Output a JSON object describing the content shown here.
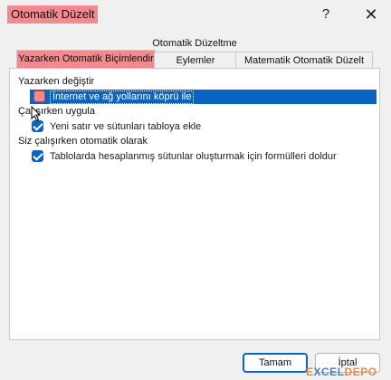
{
  "window": {
    "title": "Otomatik Düzelt",
    "help_icon": "?",
    "close_icon": "✕"
  },
  "tabs": {
    "row1": "Otomatik Düzeltme",
    "active": "Yazarken Otomatik Biçimlendir",
    "eylemler": "Eylemler",
    "math": "Matematik Otomatik Düzelt"
  },
  "sections": [
    {
      "label": "Yazarken değiştir",
      "items": [
        {
          "label": "İnternet ve ağ yollarını köprü ile",
          "checked": false,
          "selected": true
        }
      ]
    },
    {
      "label": "Çalışırken uygula",
      "items": [
        {
          "label": "Yeni satır ve sütunları tabloya ekle",
          "checked": true,
          "selected": false
        }
      ]
    },
    {
      "label": "Siz çalışırken otomatik olarak",
      "items": [
        {
          "label": "Tablolarda hesaplanmış sütunlar oluşturmak için formülleri doldur",
          "checked": true,
          "selected": false
        }
      ]
    }
  ],
  "buttons": {
    "ok": "Tamam",
    "cancel": "İptal"
  },
  "watermark": {
    "text_a": "E",
    "text_b": "XCEL",
    "text_c": "DEPO"
  },
  "colors": {
    "highlight": "#f08a8f",
    "accent": "#0a64c2"
  }
}
